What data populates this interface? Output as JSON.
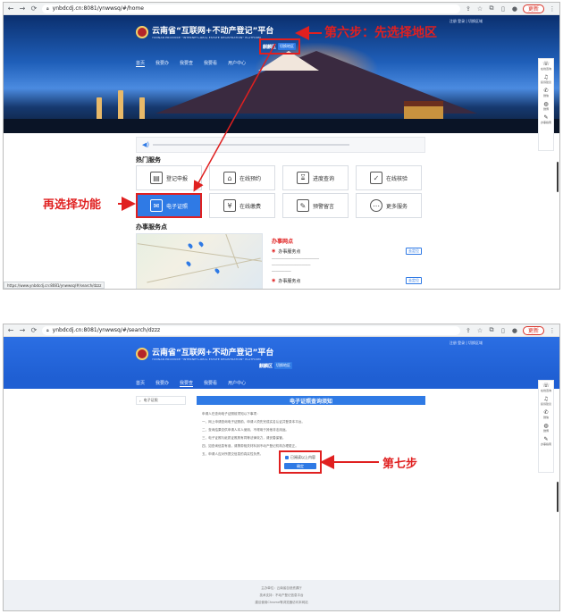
{
  "browser_top": {
    "url": "ynbdcdj.cn:8081/ynwwsq/#/home",
    "update_label": "更新"
  },
  "site": {
    "title": "云南省“互联网+不动产登记”平台",
    "subtitle": "YUNNAN PROVINCE \"INTERNET+REAL ESTATE REGISTRATION\" PLATFORM",
    "region_label": "麒麟区",
    "region_button": "切换地区",
    "top_links": "注册 登录  |  切换区域",
    "menu": [
      "首页",
      "我要办",
      "我要查",
      "我要看",
      "用户中心"
    ]
  },
  "hot_services": {
    "title": "热门服务",
    "items": [
      {
        "label": "登记申报",
        "icon": "form-icon"
      },
      {
        "label": "在线预约",
        "icon": "calendar-icon"
      },
      {
        "label": "进度查询",
        "icon": "hourglass-icon"
      },
      {
        "label": "在线核验",
        "icon": "shield-check-icon"
      },
      {
        "label": "电子证照",
        "icon": "certificate-icon"
      },
      {
        "label": "在线缴费",
        "icon": "money-bag-icon"
      },
      {
        "label": "预警留言",
        "icon": "edit-icon"
      },
      {
        "label": "更多服务",
        "icon": "more-icon"
      }
    ]
  },
  "offices": {
    "section_title": "办事服务点",
    "panel_title": "办事网点",
    "list": [
      {
        "name": "办事服务点",
        "tag": "去定位"
      },
      {
        "name": "办事服务点",
        "tag": "去定位"
      }
    ]
  },
  "status_url": "https://www.ynbdcdj.cn:8081/ynwwsq/#/search/dzzz",
  "side_rail": [
    {
      "label": "在线咨询",
      "icon": "chat-icon"
    },
    {
      "label": "投诉建议",
      "icon": "headset-icon"
    },
    {
      "label": "微信",
      "icon": "wechat-icon"
    },
    {
      "label": "微博",
      "icon": "weibo-icon"
    },
    {
      "label": "办事指南",
      "icon": "guide-icon"
    }
  ],
  "annotations": {
    "step6": "第六步：先选择地区",
    "pick_function": "再选择功能",
    "step7": "第七步"
  },
  "browser_bottom": {
    "url": "ynbdcdj.cn:8081/ynwwsq/#/search/dzzz",
    "update_label": "更新"
  },
  "doc": {
    "sidebar_item": "电子证照",
    "title": "电子证照查询须知",
    "lines": [
      "申请人在查询电子证照前须知以下事项：",
      "一、网上申请查询电子证照前，申请人须先完成实名认证并登录本平台。",
      "二、查询结果仅供申请人本人使用，不得用于其他非法用途。",
      "三、电子证照与纸质证照具有同等法律效力，请妥善保管。",
      "四、如查询信息有误，请携带相关材料到不动产登记机构办理更正。",
      "五、申请人应对所提交信息的真实性负责。"
    ],
    "agree_label": "已阅读以上内容",
    "confirm_label": "确定"
  },
  "footer": {
    "line1": "主办单位：云南省自然资源厅",
    "line2": "技术支持：不动产登记信息平台",
    "line3": "建议使用Chrome等浏览器访问本网站"
  }
}
